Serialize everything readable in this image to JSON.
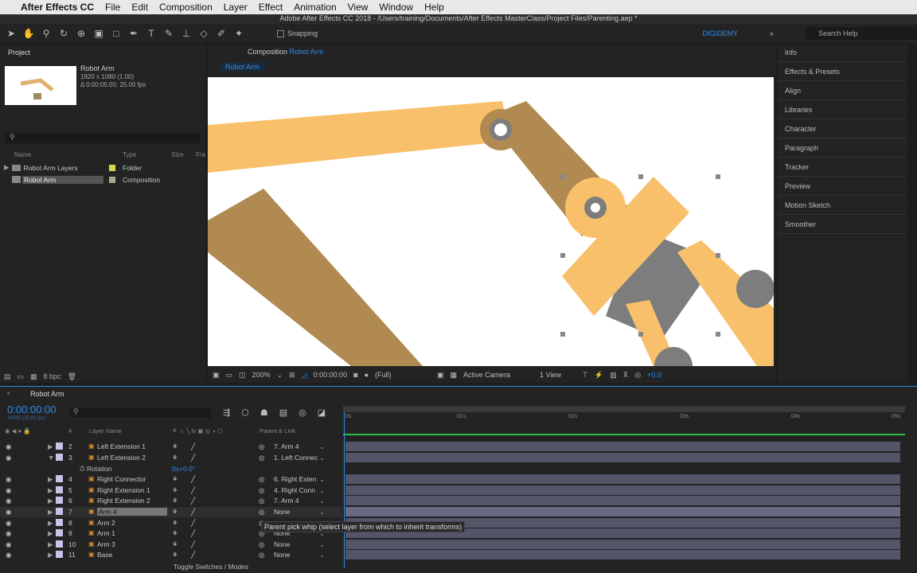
{
  "menubar": {
    "app": "After Effects CC",
    "items": [
      "File",
      "Edit",
      "Composition",
      "Layer",
      "Effect",
      "Animation",
      "View",
      "Window",
      "Help"
    ]
  },
  "window_title": "Adobe After Effects CC 2018 - /Users/training/Documents/After Effects MasterClass/Project Files/Parenting.aep *",
  "toolbar": {
    "snapping": "Snapping",
    "workspace": "DIGIDEMY",
    "search_placeholder": "Search Help"
  },
  "project": {
    "title": "Project",
    "item_name": "Robot Arm",
    "item_res": "1920 x 1080 (1.00)",
    "item_dur": "Δ 0:00:05:00, 25.00 fps",
    "columns": [
      "Name",
      "Type",
      "Size",
      "Fra"
    ],
    "rows": [
      {
        "name": "Robot Arm Layers",
        "type": "Folder",
        "color": "#d8d84a"
      },
      {
        "name": "Robot Arm",
        "type": "Composition",
        "color": "#a8a890"
      }
    ],
    "bpc": "8 bpc"
  },
  "composition": {
    "title": "Composition",
    "name": "Robot Arm",
    "tab": "Robot Arm",
    "zoom": "200%",
    "time": "0:00:00:00",
    "resolution": "(Full)",
    "camera": "Active Camera",
    "views": "1 View",
    "exposure": "+0.0"
  },
  "right_panels": [
    "Info",
    "Effects & Presets",
    "Align",
    "Libraries",
    "Character",
    "Paragraph",
    "Tracker",
    "Preview",
    "Motion Sketch",
    "Smoother"
  ],
  "timeline": {
    "tab": "Robot Arm",
    "timecode": "0:00:00:00",
    "timecode_sub": "00000 (25.00 fps)",
    "col_layer": "Layer Name",
    "col_num": "#",
    "col_parent": "Parent & Link",
    "ruler": [
      "0s",
      "01s",
      "02s",
      "03s",
      "04s",
      "05s"
    ],
    "layers": [
      {
        "num": "2",
        "name": "Left Extension 1",
        "parent": "7. Arm 4"
      },
      {
        "num": "3",
        "name": "Left Extension 2",
        "parent": "1. Left Connec"
      },
      {
        "num": "4",
        "name": "Right Connector",
        "parent": "6. Right Exten"
      },
      {
        "num": "5",
        "name": "Right Extension 1",
        "parent": "4. Right Conn"
      },
      {
        "num": "6",
        "name": "Right Extension 2",
        "parent": "7. Arm 4"
      },
      {
        "num": "7",
        "name": "Arm 4",
        "parent": "None"
      },
      {
        "num": "8",
        "name": "Arm 2",
        "parent": ""
      },
      {
        "num": "9",
        "name": "Arm 1",
        "parent": "None"
      },
      {
        "num": "10",
        "name": "Arm 3",
        "parent": "None"
      },
      {
        "num": "11",
        "name": "Base",
        "parent": "None"
      }
    ],
    "rotation_label": "Rotation",
    "rotation_value": "0x+0.0°",
    "tooltip": "Parent pick whip (select layer from which to inherit transforms)",
    "toggle": "Toggle Switches / Modes"
  },
  "colors": {
    "accent": "#2d8ceb",
    "arm_light": "#f9c06b",
    "arm_dark": "#b08a50",
    "joint": "#7d7d7d"
  }
}
